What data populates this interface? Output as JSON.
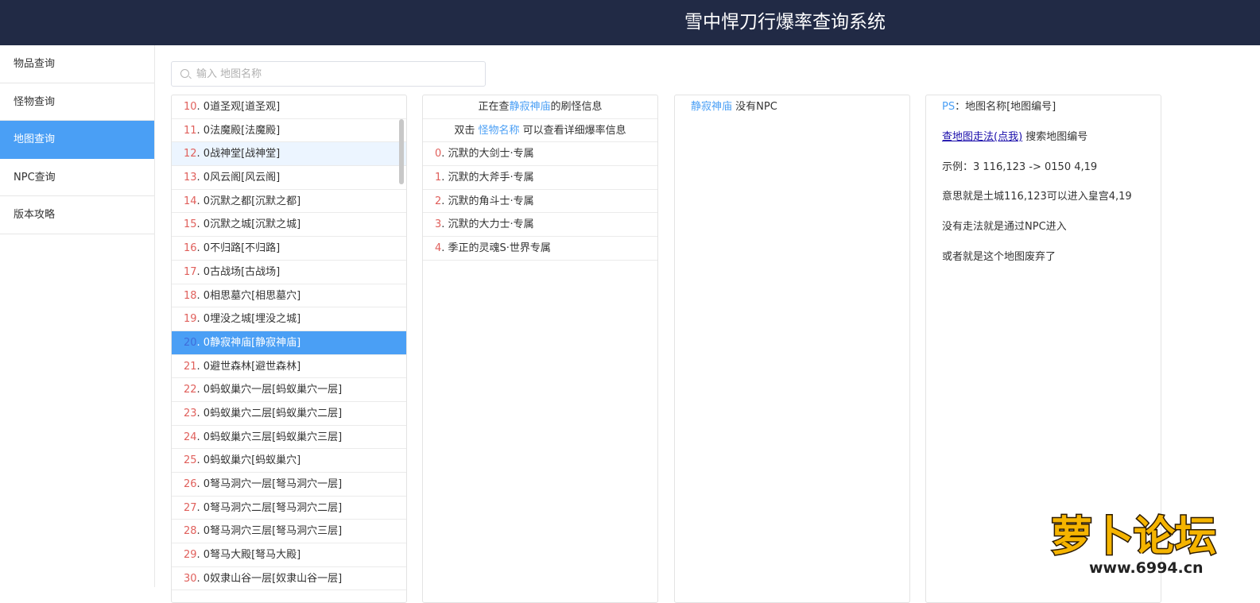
{
  "header": {
    "title": "雪中悍刀行爆率查询系统"
  },
  "sidebar": {
    "items": [
      {
        "label": "物品查询",
        "active": false
      },
      {
        "label": "怪物查询",
        "active": false
      },
      {
        "label": "地图查询",
        "active": true
      },
      {
        "label": "NPC查询",
        "active": false
      },
      {
        "label": "版本攻略",
        "active": false
      }
    ]
  },
  "search": {
    "placeholder": "输入 地图名称",
    "value": ""
  },
  "map_list": {
    "items": [
      {
        "num": "10",
        "name": ". 0道圣观[道圣观]"
      },
      {
        "num": "11",
        "name": ". 0法魔殿[法魔殿]"
      },
      {
        "num": "12",
        "name": ". 0战神堂[战神堂]"
      },
      {
        "num": "13",
        "name": ". 0风云阁[风云阁]"
      },
      {
        "num": "14",
        "name": ". 0沉默之都[沉默之都]"
      },
      {
        "num": "15",
        "name": ". 0沉默之城[沉默之城]"
      },
      {
        "num": "16",
        "name": ". 0不归路[不归路]"
      },
      {
        "num": "17",
        "name": ". 0古战场[古战场]"
      },
      {
        "num": "18",
        "name": ". 0相思墓穴[相思墓穴]"
      },
      {
        "num": "19",
        "name": ". 0埋没之城[埋没之城]"
      },
      {
        "num": "20",
        "name": ". 0静寂神庙[静寂神庙]"
      },
      {
        "num": "21",
        "name": ". 0避世森林[避世森林]"
      },
      {
        "num": "22",
        "name": ". 0蚂蚁巢穴一层[蚂蚁巢穴一层]"
      },
      {
        "num": "23",
        "name": ". 0蚂蚁巢穴二层[蚂蚁巢穴二层]"
      },
      {
        "num": "24",
        "name": ". 0蚂蚁巢穴三层[蚂蚁巢穴三层]"
      },
      {
        "num": "25",
        "name": ". 0蚂蚁巢穴[蚂蚁巢穴]"
      },
      {
        "num": "26",
        "name": ". 0弩马洞穴一层[弩马洞穴一层]"
      },
      {
        "num": "27",
        "name": ". 0弩马洞穴二层[弩马洞穴二层]"
      },
      {
        "num": "28",
        "name": ". 0弩马洞穴三层[弩马洞穴三层]"
      },
      {
        "num": "29",
        "name": ". 0弩马大殿[弩马大殿]"
      },
      {
        "num": "30",
        "name": ". 0奴隶山谷一层[奴隶山谷一层]"
      }
    ]
  },
  "monster_panel": {
    "header_prefix": "正在查",
    "map_name": "静寂神庙",
    "header_suffix": "的刷怪信息",
    "hint_prefix": "双击 ",
    "hint_link": "怪物名称",
    "hint_suffix": " 可以查看详细爆率信息",
    "items": [
      {
        "num": "0",
        "name": ". 沉默的大剑士·专属"
      },
      {
        "num": "1",
        "name": ". 沉默的大斧手·专属"
      },
      {
        "num": "2",
        "name": ". 沉默的角斗士·专属"
      },
      {
        "num": "3",
        "name": ". 沉默的大力士·专属"
      },
      {
        "num": "4",
        "name": ". 季正的灵魂S·世界专属"
      }
    ]
  },
  "npc_panel": {
    "map_name": "静寂神庙",
    "text": " 没有NPC"
  },
  "info_panel": {
    "ps_label": "PS",
    "ps_text": "：地图名称[地图编号]",
    "link_text": "查地图走法(点我)",
    "link_suffix": " 搜索地图编号",
    "example": "示例：3 116,123 -> 0150 4,19",
    "meaning": "意思就是土城116,123可以进入皇宫4,19",
    "no_path": "没有走法就是通过NPC进入",
    "abandoned": "或者就是这个地图废弃了"
  },
  "watermark": {
    "brand": "萝卜论坛",
    "url": "www.6994.cn"
  },
  "colors": {
    "header_bg": "#212a45",
    "accent": "#4a9ff5",
    "number": "#e0605c",
    "link": "#1a0dab"
  }
}
